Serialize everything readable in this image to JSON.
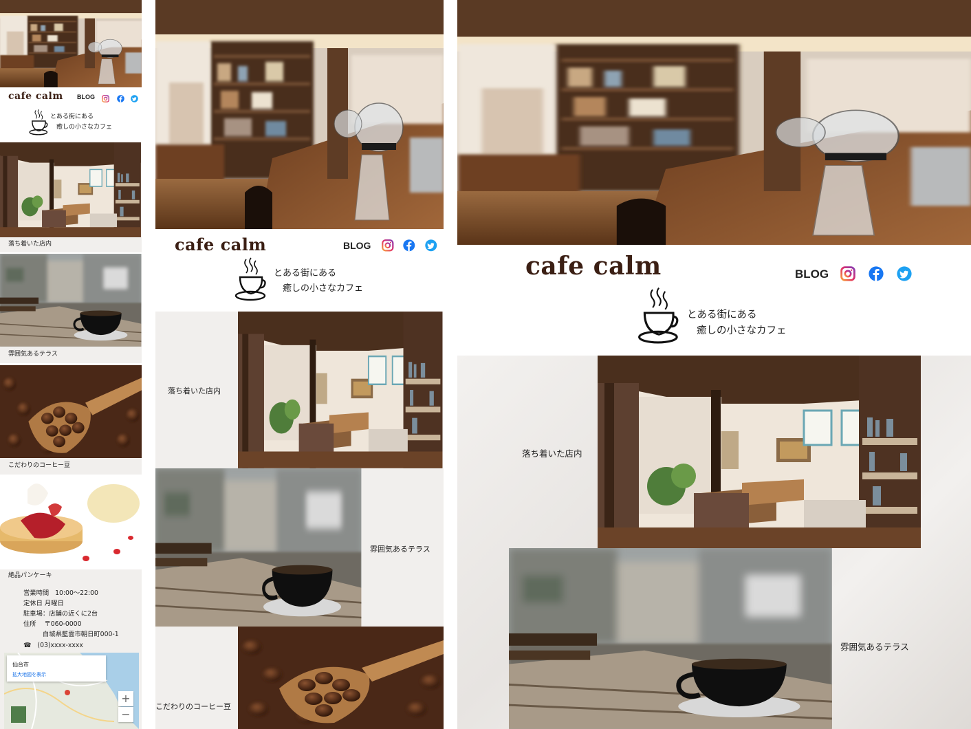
{
  "brand": {
    "name": "cafe calm",
    "tagline_1": "とある街にある",
    "tagline_2": "癒しの小さなカフェ"
  },
  "nav": {
    "blog_label": "BLOG"
  },
  "social": [
    "instagram-icon",
    "facebook-icon",
    "twitter-icon"
  ],
  "sections": {
    "interior": "落ち着いた店内",
    "terrace": "雰囲気あるテラス",
    "beans": "こだわりのコーヒー豆",
    "pancake": "絶品パンケーキ"
  },
  "info": {
    "hours_label": "営業時間",
    "hours_value": "10:00～22:00",
    "closed_label": "定休日",
    "closed_value": "月曜日",
    "parking": "駐車場：店舗の近くに2台",
    "address_label": "住所",
    "zip": "〒060-0000",
    "address": "白城県藍雲市朝日町000-1",
    "phone": "(03)xxxx-xxxx"
  },
  "map": {
    "place": "仙台市",
    "enlarge_link": "拡大地図を表示",
    "zoom_in": "+",
    "zoom_out": "−"
  },
  "colors": {
    "brand": "#3b1f14",
    "facebook": "#1877f2",
    "twitter": "#1da1f2",
    "instagram": "#e1306c",
    "texture": "#f1efed"
  }
}
